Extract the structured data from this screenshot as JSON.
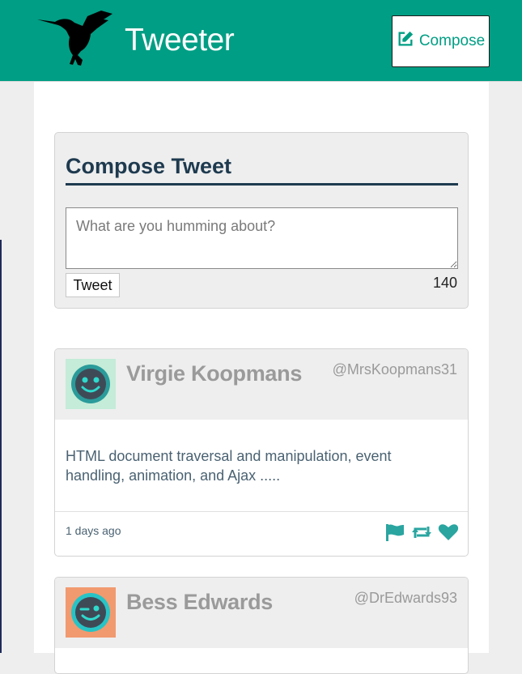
{
  "nav": {
    "brand": "Tweeter",
    "compose_label": "Compose",
    "logo_icon": "hummingbird-logo",
    "compose_icon": "edit-icon"
  },
  "compose": {
    "title": "Compose Tweet",
    "placeholder": "What are you humming about?",
    "submit_label": "Tweet",
    "counter": "140"
  },
  "tweets": [
    {
      "name": "Virgie Koopmans",
      "handle": "@MrsKoopmans31",
      "text": "HTML document traversal and manipulation, event handling, animation, and Ajax .....",
      "time": "1 days ago",
      "avatar_bg": "#c4ecd8",
      "avatar_icon": "smiley-avatar-icon"
    },
    {
      "name": "Bess Edwards",
      "handle": "@DrEdwards93",
      "avatar_bg": "#f19a6f",
      "avatar_icon": "winking-avatar-icon"
    }
  ],
  "colors": {
    "brand": "#009e84",
    "heading": "#1e3a4f",
    "action_icons": "#2aa5a0"
  },
  "action_icons": [
    "flag-icon",
    "retweet-icon",
    "heart-icon"
  ]
}
